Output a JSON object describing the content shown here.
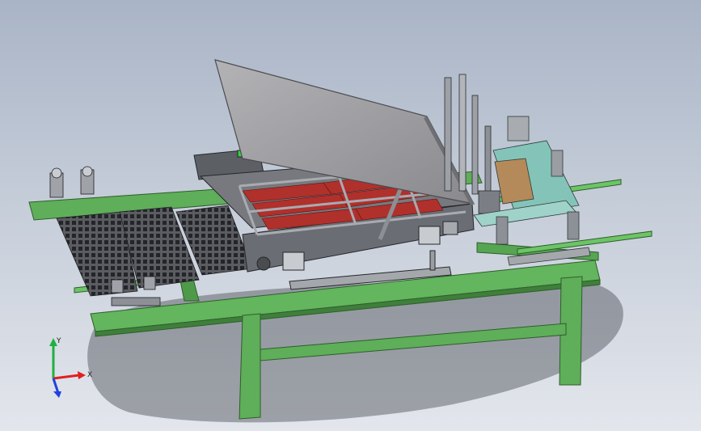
{
  "viewport": {
    "background_top": "#a9b4c6",
    "background_bottom": "#e3e6ec"
  },
  "model": {
    "frame_color": "#5fae5a",
    "frame_edge": "#2e5e2b",
    "housing_color": "#6f7278",
    "cover_color": "#9a9a9e",
    "wire_color": "#b0302c",
    "guide_color": "#84c4b8"
  },
  "triad": {
    "x_label": "X",
    "y_label": "Y",
    "x_color": "#e02020",
    "y_color": "#20b040",
    "z_color": "#2040e0"
  }
}
